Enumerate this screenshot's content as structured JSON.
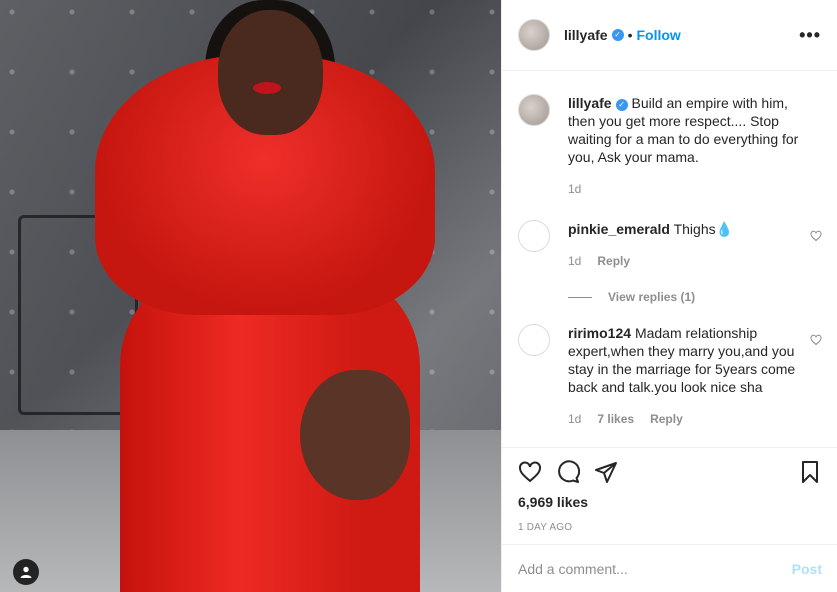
{
  "post": {
    "author": "lillyafe",
    "verified": true,
    "follow_label": "Follow",
    "dot": "•",
    "more_label": "•••"
  },
  "caption": {
    "author": "lillyafe",
    "text": "Build an empire with him, then you get more respect.... Stop waiting for a man to do everything for you, Ask your mama.",
    "time": "1d"
  },
  "comments": [
    {
      "author": "pinkie_emerald",
      "text": "Thighs💧",
      "time": "1d",
      "reply_label": "Reply",
      "view_replies": "View replies (1)"
    },
    {
      "author": "ririmo124",
      "text": "Madam relationship expert,when they marry you,and you stay in the marriage for 5years come back and talk.you look nice sha",
      "time": "1d",
      "likes": "7 likes",
      "reply_label": "Reply"
    }
  ],
  "stats": {
    "likes": "6,969 likes",
    "posted": "1 DAY AGO"
  },
  "composer": {
    "placeholder": "Add a comment...",
    "post_label": "Post"
  },
  "icons": [
    "heart-icon",
    "comment-icon",
    "share-icon",
    "bookmark-icon",
    "more-icon",
    "user-tag-icon",
    "verified-icon"
  ],
  "colors": {
    "link": "#0095f6",
    "muted": "#8e8e8e",
    "verified": "#3897f0",
    "post_disabled": "#b2dffc",
    "dress": "#e2231c"
  }
}
